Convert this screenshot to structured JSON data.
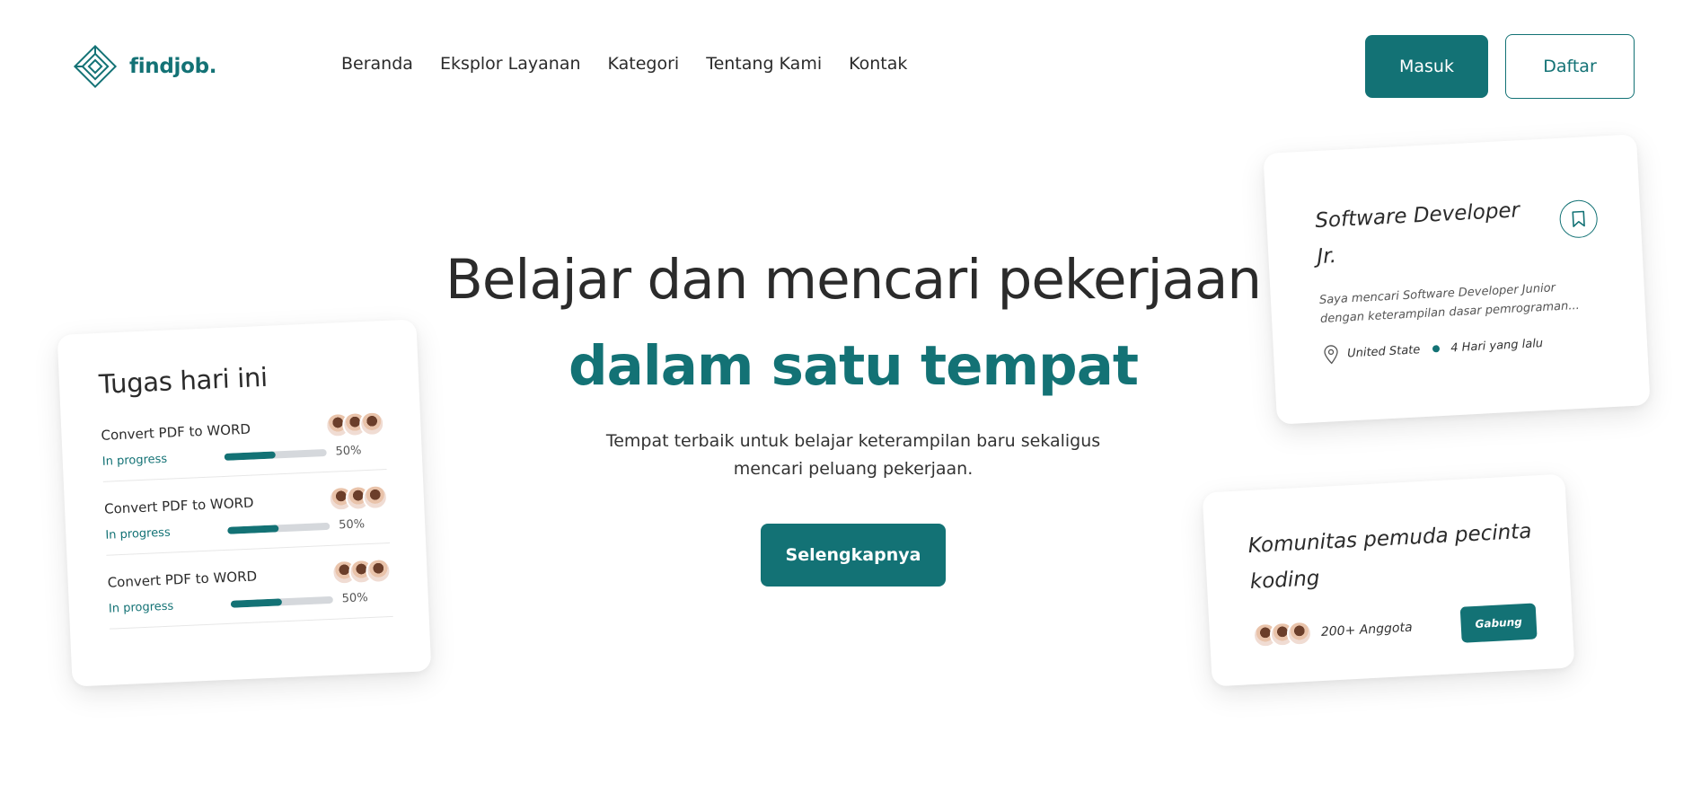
{
  "brand": {
    "name": "findjob.",
    "color": "#137275",
    "logo_icon": "diamond-logo-icon"
  },
  "nav": {
    "items": [
      {
        "label": "Beranda"
      },
      {
        "label": "Eksplor Layanan"
      },
      {
        "label": "Kategori"
      },
      {
        "label": "Tentang Kami"
      },
      {
        "label": "Kontak"
      }
    ]
  },
  "auth": {
    "login_label": "Masuk",
    "register_label": "Daftar"
  },
  "hero": {
    "title": "Belajar dan mencari pekerjaan",
    "title_accent": "dalam satu tempat",
    "subtitle": "Tempat terbaik untuk belajar keterampilan baru sekaligus mencari peluang pekerjaan.",
    "cta_label": "Selengkapnya"
  },
  "tasks_card": {
    "title": "Tugas hari ini",
    "tasks": [
      {
        "name": "Convert PDF to WORD",
        "status": "In progress",
        "progress_label": "50%",
        "progress": 0.5
      },
      {
        "name": "Convert PDF to WORD",
        "status": "In progress",
        "progress_label": "50%",
        "progress": 0.5
      },
      {
        "name": "Convert PDF to WORD",
        "status": "In progress",
        "progress_label": "50%",
        "progress": 0.5
      }
    ]
  },
  "job_card": {
    "title": "Software Developer Jr.",
    "description": "Saya mencari Software Developer Junior dengan keterampilan dasar pemrograman...",
    "location": "United State",
    "posted": "4 Hari yang lalu",
    "icons": [
      "bookmark-icon",
      "location-pin-icon"
    ]
  },
  "community_card": {
    "title": "Komunitas pemuda pecinta koding",
    "members": "200+ Anggota",
    "join_label": "Gabung"
  }
}
